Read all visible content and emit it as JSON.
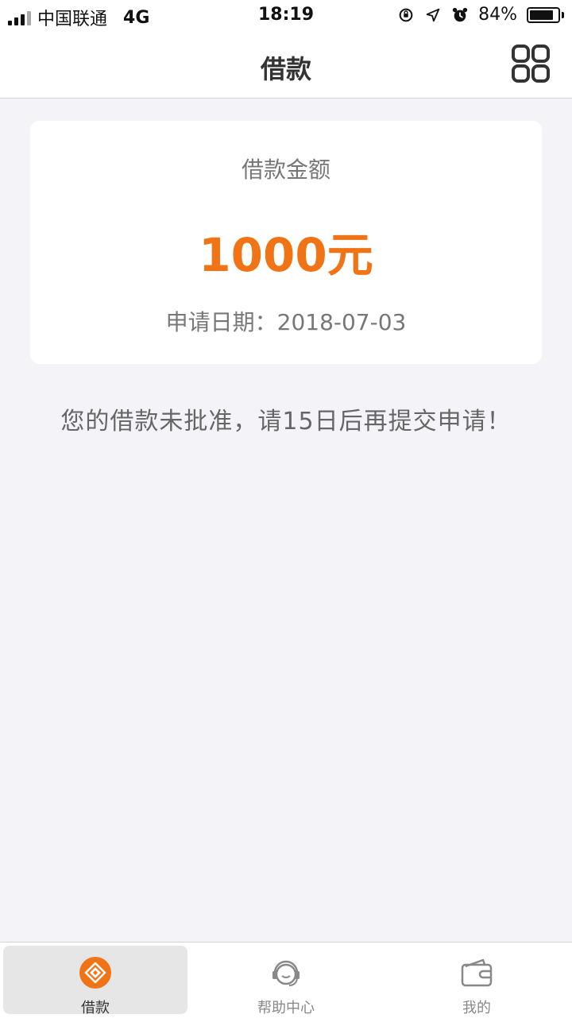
{
  "status_bar": {
    "carrier": "中国联通",
    "network": "4G",
    "time": "18:19",
    "battery": "84%"
  },
  "nav": {
    "title": "借款"
  },
  "loan_card": {
    "label": "借款金额",
    "amount": "1000元",
    "date": "申请日期：2018-07-03"
  },
  "notice": "您的借款未批准，请15日后再提交申请！",
  "tabs": [
    {
      "label": "借款",
      "icon": "loan-icon",
      "active": true
    },
    {
      "label": "帮助中心",
      "icon": "headset-icon",
      "active": false
    },
    {
      "label": "我的",
      "icon": "wallet-icon",
      "active": false
    }
  ],
  "colors": {
    "accent": "#f07415",
    "background": "#f4f4f8"
  }
}
